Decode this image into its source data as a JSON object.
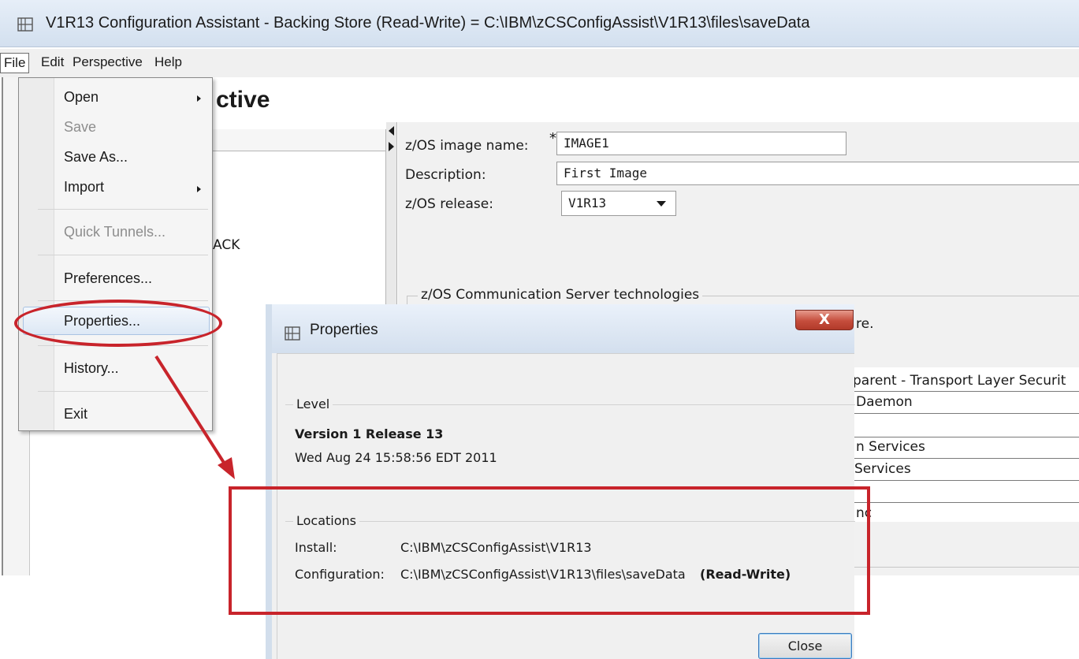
{
  "window": {
    "title": "V1R13 Configuration Assistant - Backing Store (Read-Write) = C:\\IBM\\zCSConfigAssist\\V1R13\\files\\saveData",
    "app_icon": "config-assistant-icon"
  },
  "menubar": {
    "items": [
      {
        "label": "File"
      },
      {
        "label": "Edit"
      },
      {
        "label": "Perspective"
      },
      {
        "label": "Help"
      }
    ]
  },
  "file_menu": {
    "items": [
      {
        "label": "Open",
        "submenu": true,
        "enabled": true
      },
      {
        "label": "Save",
        "submenu": false,
        "enabled": false
      },
      {
        "label": "Save As...",
        "submenu": false,
        "enabled": true
      },
      {
        "label": "Import",
        "submenu": true,
        "enabled": true
      },
      {
        "label": "Quick Tunnels...",
        "submenu": false,
        "enabled": false
      },
      {
        "label": "Preferences...",
        "submenu": false,
        "enabled": true
      },
      {
        "label": "Properties...",
        "submenu": false,
        "enabled": true,
        "highlighted": true
      },
      {
        "label": "History...",
        "submenu": false,
        "enabled": true
      },
      {
        "label": "Exit",
        "submenu": false,
        "enabled": true
      }
    ]
  },
  "background": {
    "perspective_title_fragment": "ctive",
    "tree_fragment": "ACK",
    "image_name_label": "z/OS image name:",
    "image_name_value": "IMAGE1",
    "required_marker": "*",
    "description_label": "Description:",
    "description_value": "First Image",
    "release_label": "z/OS release:",
    "release_value": "V1R13",
    "technologies_group": "z/OS Communication Server technologies",
    "fragment_re": "re.",
    "fragment_tls": "parent - Transport Layer Securit",
    "fragment_daemon": "Daemon",
    "fragment_services1": "n Services",
    "fragment_services2": "Services",
    "fragment_nc": "nc"
  },
  "properties_dialog": {
    "title": "Properties",
    "close_x": "X",
    "level_group": "Level",
    "version": "Version 1 Release 13",
    "build_date": "Wed Aug 24 15:58:56 EDT 2011",
    "locations_group": "Locations",
    "install_label": "Install:",
    "install_path": "C:\\IBM\\zCSConfigAssist\\V1R13",
    "config_label": "Configuration:",
    "config_path": "C:\\IBM\\zCSConfigAssist\\V1R13\\files\\saveData",
    "config_mode": "(Read-Write)",
    "close_button": "Close"
  },
  "colors": {
    "annotation": "#c8242b",
    "menu_highlight": "#dde8f5",
    "dialog_close": "#c54d3c"
  }
}
